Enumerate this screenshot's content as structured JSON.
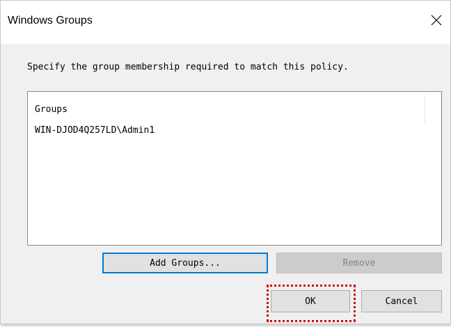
{
  "window": {
    "title": "Windows Groups",
    "close_icon": "close-icon"
  },
  "instruction": "Specify the group membership required to match this policy.",
  "groups_list": {
    "column_header": "Groups",
    "rows": [
      "WIN-DJOD4Q257LD\\Admin1"
    ]
  },
  "buttons": {
    "add_groups": "Add Groups...",
    "remove": "Remove",
    "ok": "OK",
    "cancel": "Cancel"
  },
  "colors": {
    "focus_border": "#0078d7",
    "highlight_annotation": "#cc0000",
    "dialog_background": "#f0f0f0"
  }
}
